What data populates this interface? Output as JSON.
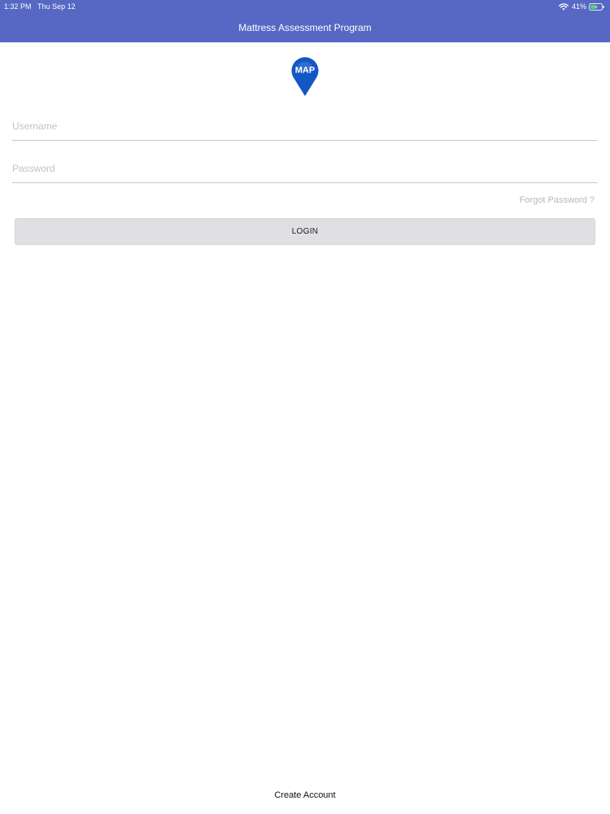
{
  "status_bar": {
    "time": "1:32 PM",
    "date": "Thu Sep 12",
    "battery_percent": "41%",
    "icons": [
      "wifi-icon",
      "battery-icon"
    ]
  },
  "navigation": {
    "title": "Mattress Assessment Program"
  },
  "logo": {
    "text": "MAP",
    "color": "#1257c4"
  },
  "form": {
    "username": {
      "placeholder": "Username",
      "value": ""
    },
    "password": {
      "placeholder": "Password",
      "value": ""
    },
    "forgot_password_label": "Forgot Password ?",
    "login_label": "LOGIN"
  },
  "footer": {
    "create_account_label": "Create Account"
  },
  "colors": {
    "header_bar": "#5668c4",
    "button_bg": "#e0dfe3",
    "placeholder": "#c2c2c8"
  }
}
